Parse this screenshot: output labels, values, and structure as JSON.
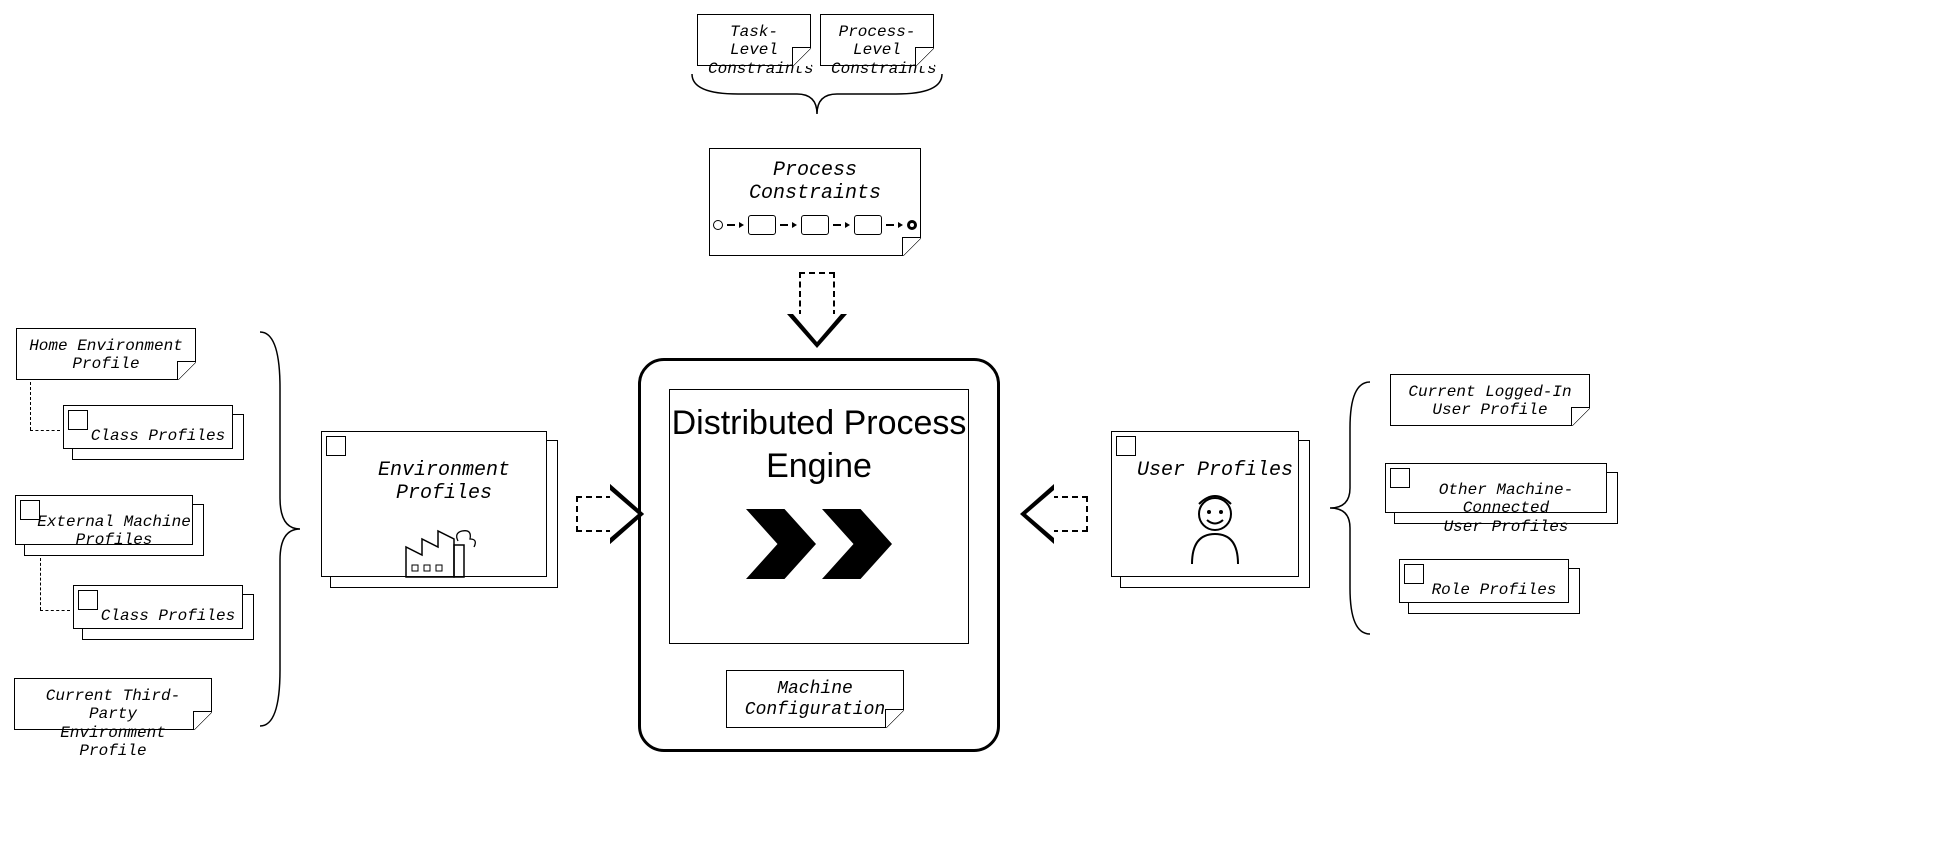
{
  "top": {
    "task_constraints": "Task-Level\nConstraints",
    "process_constraints_small": "Process-Level\nConstraints",
    "process_constraints": "Process Constraints"
  },
  "center": {
    "engine_title": "Distributed Process\nEngine",
    "machine_config": "Machine\nConfiguration"
  },
  "left": {
    "env_profiles": "Environment Profiles",
    "home_env": "Home Environment\nProfile",
    "class_profiles_1": "Class Profiles",
    "external_machine": "External Machine\nProfiles",
    "class_profiles_2": "Class Profiles",
    "third_party": "Current Third-Party\nEnvironment Profile"
  },
  "right": {
    "user_profiles": "User Profiles",
    "logged_in": "Current Logged-In\nUser Profile",
    "other_connected": "Other Machine-Connected\nUser Profiles",
    "role_profiles": "Role Profiles"
  },
  "icons": {
    "factory": "factory-icon",
    "user": "user-icon",
    "chevrons": "chevrons-icon",
    "bpmn_mini": "bpmn-mini-flow-icon"
  }
}
